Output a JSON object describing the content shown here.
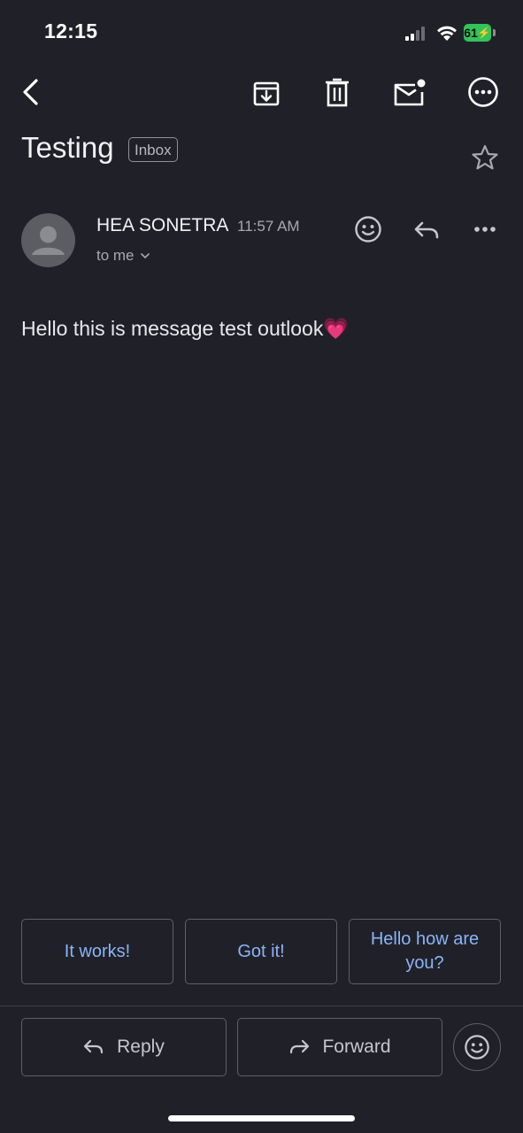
{
  "status_bar": {
    "time": "12:15",
    "battery": "61",
    "icons": [
      "signal-icon",
      "wifi-icon",
      "battery-charging-icon"
    ]
  },
  "toolbar": {
    "icons": [
      "back-icon",
      "archive-icon",
      "trash-icon",
      "mark-unread-icon",
      "more-options-icon"
    ]
  },
  "email": {
    "subject": "Testing",
    "label": "Inbox",
    "sender": "HEA SONETRA",
    "time": "11:57 AM",
    "recipient": "to me",
    "body": "Hello this is message test outlook💗"
  },
  "smart_replies": [
    "It works!",
    "Got it!",
    "Hello how are you?"
  ],
  "actions": {
    "reply": "Reply",
    "forward": "Forward"
  },
  "colors": {
    "background": "#202128",
    "accent": "#8ab4f8",
    "battery": "#32c45a"
  }
}
